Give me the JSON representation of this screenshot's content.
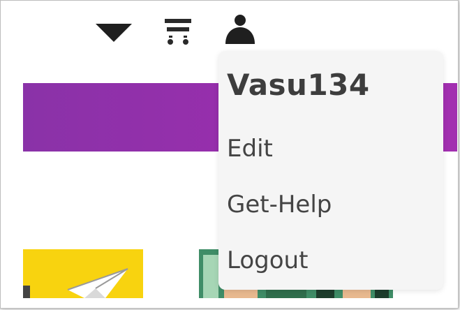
{
  "navbar": {
    "icons": [
      "caret-down-icon",
      "cart-icon",
      "user-icon"
    ]
  },
  "colors": {
    "banner": "#9a2ead",
    "dropdown_bg": "#f5f5f5",
    "card_yellow": "#f8d30f",
    "card_green": "#3f8d67"
  },
  "user_menu": {
    "username": "Vasu134",
    "items": [
      {
        "label": "Edit"
      },
      {
        "label": "Get-Help"
      },
      {
        "label": "Logout"
      }
    ]
  }
}
